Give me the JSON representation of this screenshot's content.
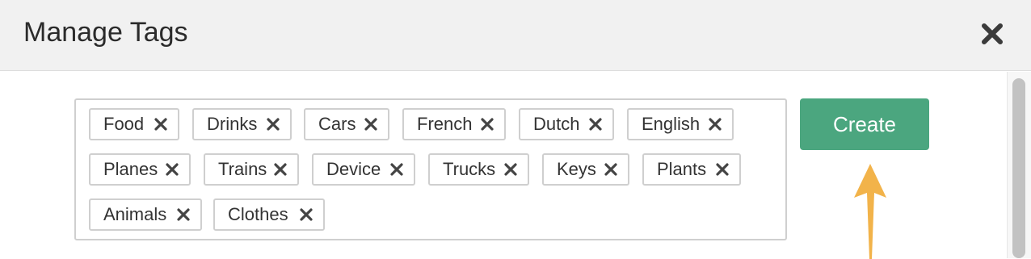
{
  "modal": {
    "title": "Manage Tags",
    "close_icon": "close-icon"
  },
  "tags": [
    {
      "label": "Food"
    },
    {
      "label": "Drinks"
    },
    {
      "label": "Cars"
    },
    {
      "label": "French"
    },
    {
      "label": "Dutch"
    },
    {
      "label": "English"
    },
    {
      "label": "Planes"
    },
    {
      "label": "Trains"
    },
    {
      "label": "Device"
    },
    {
      "label": "Trucks"
    },
    {
      "label": "Keys"
    },
    {
      "label": "Plants"
    },
    {
      "label": "Animals"
    },
    {
      "label": "Clothes"
    }
  ],
  "actions": {
    "create_label": "Create"
  },
  "colors": {
    "create_button": "#4ba67f",
    "arrow": "#f2b34a",
    "header_bg": "#f1f1f1"
  }
}
